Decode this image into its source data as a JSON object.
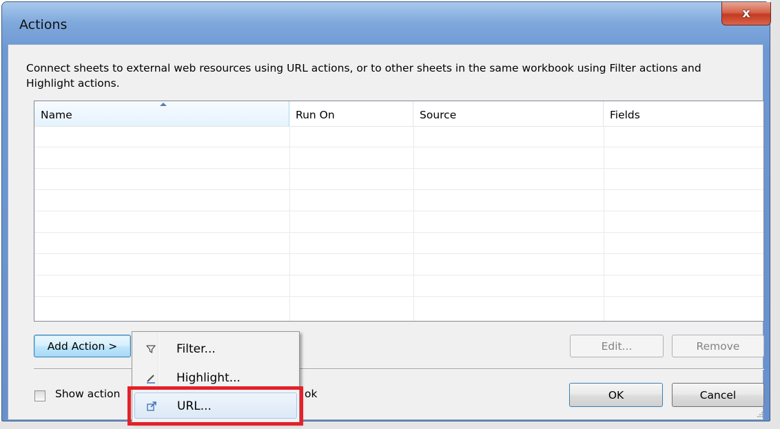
{
  "window": {
    "title": "Actions",
    "close_glyph": "x"
  },
  "description": "Connect sheets to external web resources using URL actions, or to other sheets in the same workbook using Filter actions and Highlight actions.",
  "table": {
    "columns": [
      "Name",
      "Run On",
      "Source",
      "Fields"
    ],
    "sorted_column": "Name",
    "sort_direction": "ascending",
    "rows": []
  },
  "buttons": {
    "add_action": "Add Action >",
    "edit": "Edit...",
    "remove": "Remove",
    "ok": "OK",
    "cancel": "Cancel"
  },
  "checkbox": {
    "label_visible_start": "Show action",
    "label_visible_end": "ok",
    "checked": false
  },
  "menu": {
    "items": [
      {
        "label": "Filter...",
        "icon": "filter-icon"
      },
      {
        "label": "Highlight...",
        "icon": "highlight-pen-icon"
      },
      {
        "label": "URL...",
        "icon": "external-link-icon"
      }
    ],
    "highlighted_item": "URL..."
  },
  "annotation": {
    "color": "#e4202a"
  }
}
